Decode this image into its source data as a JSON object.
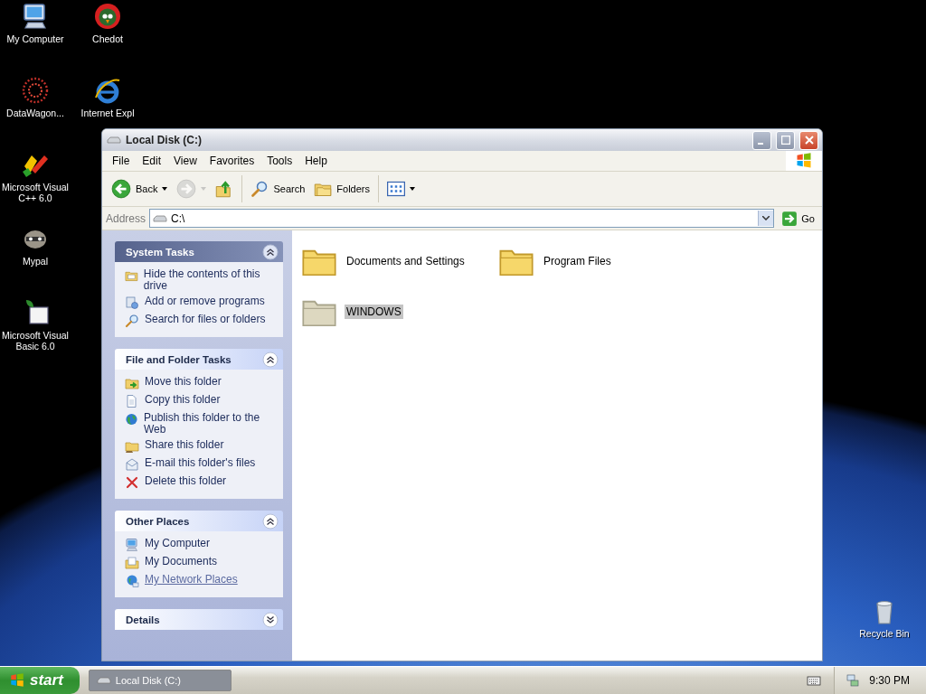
{
  "desktop": {
    "columns": [
      [
        {
          "label": "My Computer",
          "kind": "computer"
        },
        {
          "label": "DataWagon...",
          "kind": "datawagon"
        },
        {
          "label": "Microsoft Visual C++ 6.0",
          "kind": "vcpp"
        },
        {
          "label": "Mypal",
          "kind": "mypal"
        },
        {
          "label": "Microsoft Visual Basic 6.0",
          "kind": "vb"
        }
      ],
      [
        {
          "label": "Chedot",
          "kind": "chedot"
        },
        {
          "label": "Internet Expl",
          "kind": "ie"
        }
      ]
    ],
    "recycle_bin": {
      "label": "Recycle Bin"
    }
  },
  "window": {
    "title": "Local Disk (C:)",
    "menu": [
      "File",
      "Edit",
      "View",
      "Favorites",
      "Tools",
      "Help"
    ],
    "toolbar": [
      {
        "kind": "back",
        "label": "Back",
        "disabled": false,
        "dropdown": true
      },
      {
        "kind": "forward",
        "disabled": true,
        "dropdown": true
      },
      {
        "kind": "up",
        "disabled": false,
        "dropdown": false
      },
      {
        "kind": "search",
        "label": "Search",
        "disabled": false,
        "dropdown": false
      },
      {
        "kind": "folders",
        "label": "Folders",
        "disabled": false,
        "dropdown": false
      },
      {
        "kind": "views",
        "disabled": false,
        "dropdown": true
      }
    ],
    "address": {
      "label": "Address",
      "value": "C:\\",
      "go": "Go"
    },
    "panels": [
      {
        "title": "System Tasks",
        "expanded": true,
        "primary": true,
        "items": [
          {
            "label": "Hide the contents of this drive",
            "kind": "hide",
            "hovered": false
          },
          {
            "label": "Add or remove programs",
            "kind": "addremove",
            "hovered": false
          },
          {
            "label": "Search for files or folders",
            "kind": "search",
            "hovered": false
          }
        ]
      },
      {
        "title": "File and Folder Tasks",
        "expanded": true,
        "primary": false,
        "items": [
          {
            "label": "Move this folder",
            "kind": "move",
            "hovered": false
          },
          {
            "label": "Copy this folder",
            "kind": "copy",
            "hovered": false
          },
          {
            "label": "Publish this folder to the Web",
            "kind": "globe",
            "hovered": false
          },
          {
            "label": "Share this folder",
            "kind": "share",
            "hovered": false
          },
          {
            "label": "E-mail this folder's files",
            "kind": "mail",
            "hovered": false
          },
          {
            "label": "Delete this folder",
            "kind": "delete",
            "hovered": false
          }
        ]
      },
      {
        "title": "Other Places",
        "expanded": true,
        "primary": false,
        "items": [
          {
            "label": "My Computer",
            "kind": "computer",
            "hovered": false
          },
          {
            "label": "My Documents",
            "kind": "docs",
            "hovered": false
          },
          {
            "label": "My Network Places",
            "kind": "network",
            "hovered": true
          }
        ]
      },
      {
        "title": "Details",
        "expanded": false,
        "primary": false
      }
    ],
    "folders": [
      {
        "name": "Documents and Settings",
        "selected": false
      },
      {
        "name": "Program Files",
        "selected": false
      },
      {
        "name": "WINDOWS",
        "selected": true
      }
    ]
  },
  "taskbar": {
    "start": "start",
    "tasks": [
      {
        "label": "Local Disk (C:)",
        "selected": true
      }
    ],
    "clock": "9:30 PM"
  }
}
